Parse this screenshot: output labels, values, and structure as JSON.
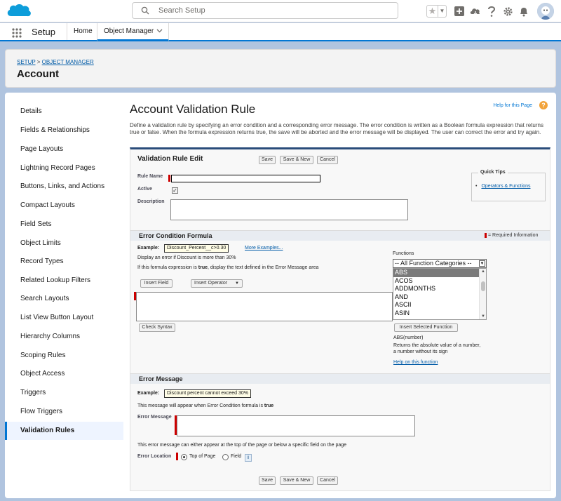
{
  "global_header": {
    "search_placeholder": "Search Setup"
  },
  "app_nav": {
    "app_name": "Setup",
    "tabs": [
      {
        "label": "Home"
      },
      {
        "label": "Object Manager"
      }
    ]
  },
  "object_header": {
    "breadcrumb_setup": "SETUP",
    "breadcrumb_sep": ">",
    "breadcrumb_object_manager": "OBJECT MANAGER",
    "title": "Account"
  },
  "sidebar": {
    "items": [
      {
        "label": "Details"
      },
      {
        "label": "Fields & Relationships"
      },
      {
        "label": "Page Layouts"
      },
      {
        "label": "Lightning Record Pages"
      },
      {
        "label": "Buttons, Links, and Actions"
      },
      {
        "label": "Compact Layouts"
      },
      {
        "label": "Field Sets"
      },
      {
        "label": "Object Limits"
      },
      {
        "label": "Record Types"
      },
      {
        "label": "Related Lookup Filters"
      },
      {
        "label": "Search Layouts"
      },
      {
        "label": "List View Button Layout"
      },
      {
        "label": "Hierarchy Columns"
      },
      {
        "label": "Scoping Rules"
      },
      {
        "label": "Object Access"
      },
      {
        "label": "Triggers"
      },
      {
        "label": "Flow Triggers"
      },
      {
        "label": "Validation Rules"
      }
    ],
    "active": "Validation Rules"
  },
  "content": {
    "title": "Account Validation Rule",
    "help_link": "Help for this Page",
    "intro": "Define a validation rule by specifying an error condition and a corresponding error message. The error condition is written as a Boolean formula expression that returns true or false. When the formula expression returns true, the save will be aborted and the error message will be displayed. The user can correct the error and try again."
  },
  "edit": {
    "title": "Validation Rule Edit",
    "save": "Save",
    "save_new": "Save & New",
    "cancel": "Cancel",
    "rule_name_label": "Rule Name",
    "rule_name_value": "",
    "active_label": "Active",
    "active_checked": true,
    "description_label": "Description",
    "description_value": "",
    "quick_tips_title": "Quick Tips",
    "quick_tips_link": "Operators & Functions"
  },
  "formula": {
    "section_title": "Error Condition Formula",
    "required_info": "= Required Information",
    "example_label": "Example:",
    "example_value": "Discount_Percent__c>0.30",
    "more_examples": "More Examples...",
    "example_desc": "Display an error if Discount is more than 30%",
    "instruction_pre": "If this formula expression is ",
    "instruction_bold": "true",
    "instruction_post": ", display the text defined in the Error Message area",
    "insert_field": "Insert Field",
    "insert_operator": "Insert Operator",
    "formula_value": "",
    "check_syntax": "Check Syntax",
    "functions_label": "Functions",
    "category_selected": "-- All Function Categories --",
    "functions": [
      "ABS",
      "ACOS",
      "ADDMONTHS",
      "AND",
      "ASCII",
      "ASIN"
    ],
    "selected_function": "ABS",
    "insert_selected_function": "Insert Selected Function",
    "function_signature": "ABS(number)",
    "function_desc": "Returns the absolute value of a number, a number without its sign",
    "help_on_function": "Help on this function"
  },
  "message": {
    "section_title": "Error Message",
    "example_label": "Example:",
    "example_value": "Discount percent cannot exceed 30%",
    "note_pre": "This message will appear when Error Condition formula is ",
    "note_bold": "true",
    "error_message_label": "Error Message",
    "error_message_value": "",
    "location_note": "This error message can either appear at the top of the page or below a specific field on the page",
    "error_location_label": "Error Location",
    "location_options": [
      "Top of Page",
      "Field"
    ],
    "location_selected": "Top of Page"
  },
  "colors": {
    "brand_blue": "#0176d3",
    "required_red": "#cc0000",
    "section_bar": "#2a4c7a"
  }
}
